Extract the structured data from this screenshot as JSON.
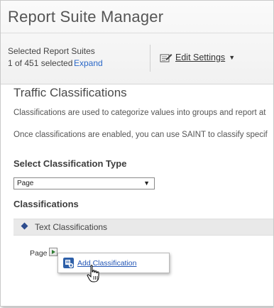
{
  "app": {
    "title": "Report Suite Manager"
  },
  "header": {
    "selected_label": "Selected Report Suites",
    "selected_count": "1 of 451 selected",
    "expand_label": "Expand",
    "edit_settings_label": "Edit Settings"
  },
  "main": {
    "section_title": "Traffic Classifications",
    "paragraph_1": "Classifications are used to categorize values into groups and report at",
    "paragraph_2": "Once classifications are enabled, you can use SAINT to classify specif",
    "select_type_heading": "Select Classification Type",
    "select_type_value": "Page",
    "classifications_heading": "Classifications",
    "text_classifications_label": "Text Classifications",
    "page_label": "Page",
    "add_classification_label": "Add Classification"
  },
  "icons": {
    "edit": "pencil-icon",
    "dropdown": "chevron-down-icon",
    "bullet": "diamond-icon",
    "expand": "play-icon",
    "add": "add-icon",
    "cursor": "hand-cursor-icon"
  },
  "colors": {
    "link": "#2b68c8",
    "accent_blue": "#2d5fa8",
    "play_green": "#2e7d32"
  }
}
